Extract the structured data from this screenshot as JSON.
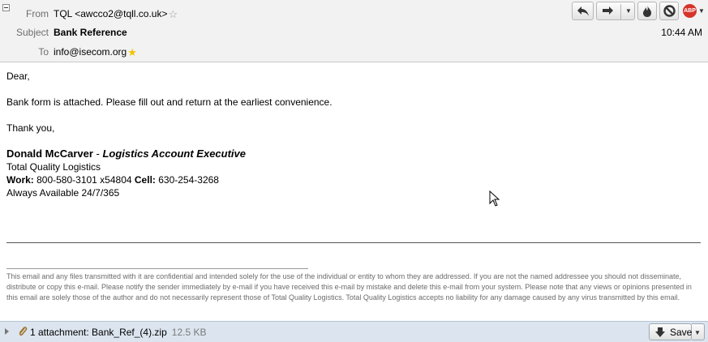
{
  "header": {
    "from_label": "From",
    "from_value": "TQL <awcco2@tqll.co.uk>",
    "subject_label": "Subject",
    "subject_value": "Bank Reference",
    "to_label": "To",
    "to_value": "info@isecom.org",
    "time": "10:44 AM"
  },
  "toolbar": {
    "icons": [
      "reply-icon",
      "forward-icon",
      "dropdown-icon",
      "junk-icon",
      "block-icon",
      "adblock-plus-icon"
    ],
    "abp_text": "ABP"
  },
  "body": {
    "greeting": "Dear,",
    "message": "Bank form is attached. Please fill out and return at the earliest convenience.",
    "closing": "Thank you,",
    "sig_name": "Donald McCarver",
    "sig_dash": " - ",
    "sig_title": "Logistics Account Executive",
    "sig_company": "Total Quality Logistics",
    "sig_work_label": "Work:",
    "sig_work": " 800-580-3101 x54804 ",
    "sig_cell_label": "Cell:",
    "sig_cell": " 630-254-3268",
    "sig_avail": "Always Available 24/7/365",
    "disclaimer": "This email and any files transmitted with it are confidential and intended solely for the use of the individual or entity to whom they are addressed. If you are not the named addressee you should not disseminate, distribute or copy this e-mail. Please notify the sender immediately by e-mail if you have received this e-mail by mistake and delete this e-mail from your system. Please note that any views or opinions presented in this email are solely those of the author and do not necessarily represent those of Total Quality Logistics. Total Quality Logistics accepts no liability for any damage caused by any virus transmitted by this email."
  },
  "attachment": {
    "summary": "1 attachment: Bank_Ref_(4).zip",
    "size": "12.5 KB",
    "save_label": "Save"
  },
  "colors": {
    "header_bg": "#f2f2f2",
    "attach_bar_bg": "#dce5ef",
    "abp_red": "#d6342b",
    "star_yellow": "#f3c200"
  }
}
